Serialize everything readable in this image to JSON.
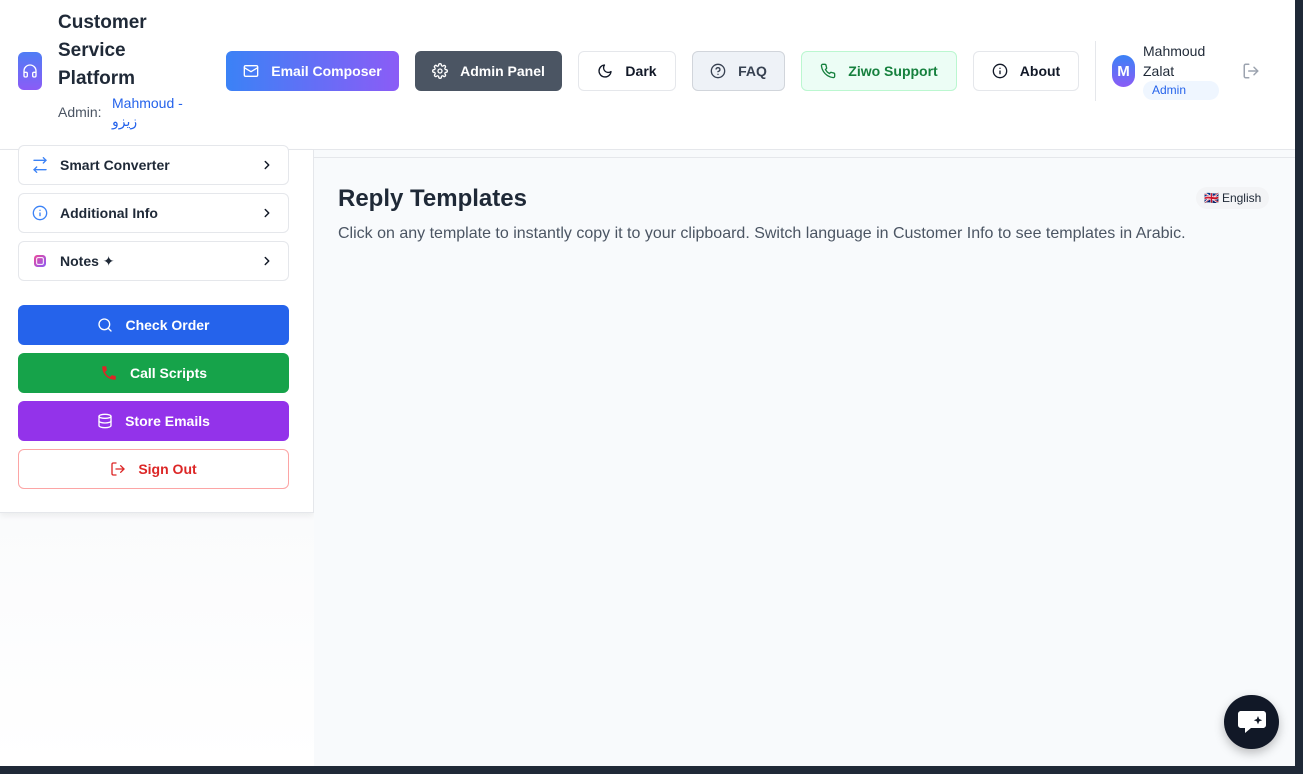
{
  "header": {
    "brand_title": "Customer Service Platform",
    "admin_label": "Admin:",
    "admin_name": "Mahmoud - زيزو",
    "buttons": {
      "email_composer": "Email Composer",
      "admin_panel": "Admin Panel",
      "dark": "Dark",
      "faq": "FAQ",
      "ziwo_support": "Ziwo Support",
      "about": "About"
    },
    "user": {
      "avatar_initial": "M",
      "name": "Mahmoud Zalat",
      "role": "Admin"
    }
  },
  "sidebar": {
    "items": [
      {
        "label": "Smart Converter",
        "icon": "arrows-exchange-icon"
      },
      {
        "label": "Additional Info",
        "icon": "info-icon"
      },
      {
        "label": "Notes ✦",
        "icon": "notes-icon"
      }
    ],
    "actions": {
      "check_order": "Check Order",
      "call_scripts": "Call Scripts",
      "store_emails": "Store Emails",
      "sign_out": "Sign Out"
    }
  },
  "main": {
    "title": "Reply Templates",
    "description": "Click on any template to instantly copy it to your clipboard. Switch language in Customer Info to see templates in Arabic.",
    "language_flag": "🇬🇧",
    "language": "English"
  },
  "colors": {
    "primary_blue": "#2563eb",
    "success_green": "#16a34a",
    "purple": "#9333ea",
    "danger_red": "#dc2626",
    "admin_gray": "#4b5563"
  }
}
